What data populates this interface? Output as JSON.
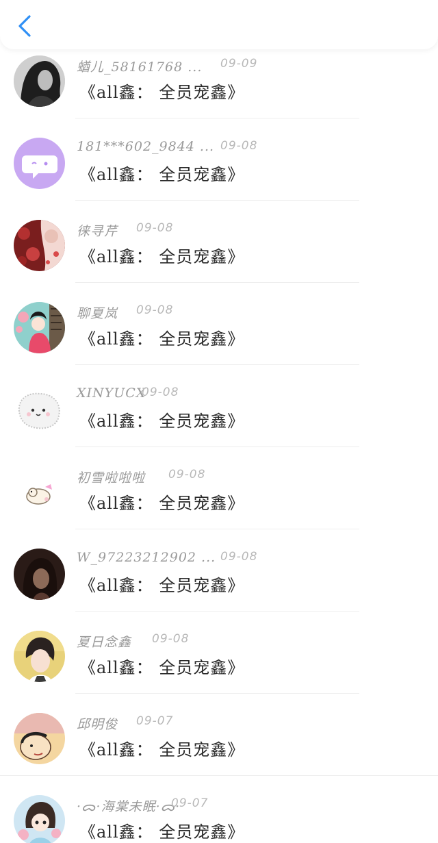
{
  "header": {
    "back_icon": "chevron-left-icon",
    "accent_color": "#2f8ff5"
  },
  "comments": [
    {
      "username": "蝤儿_58161768 ...",
      "date": "09-09",
      "content": "《all鑫： 全员宠鑫》"
    },
    {
      "username": "181***602_9844 ...",
      "date": "09-08",
      "content": "《all鑫： 全员宠鑫》"
    },
    {
      "username": "徕寻芹",
      "date": "09-08",
      "content": "《all鑫： 全员宠鑫》"
    },
    {
      "username": "聊夏岚",
      "date": "09-08",
      "content": "《all鑫： 全员宠鑫》"
    },
    {
      "username": "XINYUCX",
      "date": "09-08",
      "content": "《all鑫： 全员宠鑫》"
    },
    {
      "username": "初雪啦啦啦",
      "date": "09-08",
      "content": "《all鑫： 全员宠鑫》"
    },
    {
      "username": "W_97223212902 ...",
      "date": "09-08",
      "content": "《all鑫： 全员宠鑫》"
    },
    {
      "username": "夏日念鑫",
      "date": "09-08",
      "content": "《all鑫： 全员宠鑫》"
    },
    {
      "username": "邱明俊",
      "date": "09-07",
      "content": "《all鑫： 全员宠鑫》"
    },
    {
      "username": "·ᯅ·海棠未眠·ᯅ·",
      "date": "09-07",
      "content": "《all鑫： 全员宠鑫》"
    }
  ]
}
